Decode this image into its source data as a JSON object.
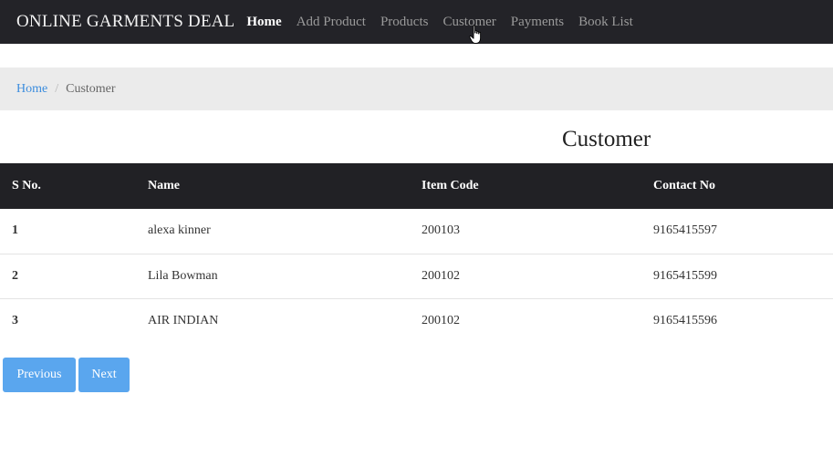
{
  "navbar": {
    "brand": "ONLINE GARMENTS DEAL",
    "links": [
      {
        "label": "Home"
      },
      {
        "label": "Add Product"
      },
      {
        "label": "Products"
      },
      {
        "label": "Customer"
      },
      {
        "label": "Payments"
      },
      {
        "label": "Book List"
      }
    ],
    "cursor_icon": "hand-pointer-icon"
  },
  "breadcrumb": {
    "home": "Home",
    "separator": "/",
    "current": "Customer"
  },
  "page_title": "Customer",
  "table": {
    "headers": [
      "S No.",
      "Name",
      "Item Code",
      "Contact No"
    ],
    "rows": [
      [
        "1",
        "alexa kinner",
        "200103",
        "9165415597"
      ],
      [
        "2",
        "Lila Bowman",
        "200102",
        "9165415599"
      ],
      [
        "3",
        "AIR INDIAN",
        "200102",
        "9165415596"
      ]
    ]
  },
  "pagination": {
    "previous": "Previous",
    "next": "Next"
  },
  "colors": {
    "navbar_bg": "#232328",
    "table_header_bg": "#212125",
    "button_bg": "#5aa6ee",
    "link": "#3c8dde"
  }
}
